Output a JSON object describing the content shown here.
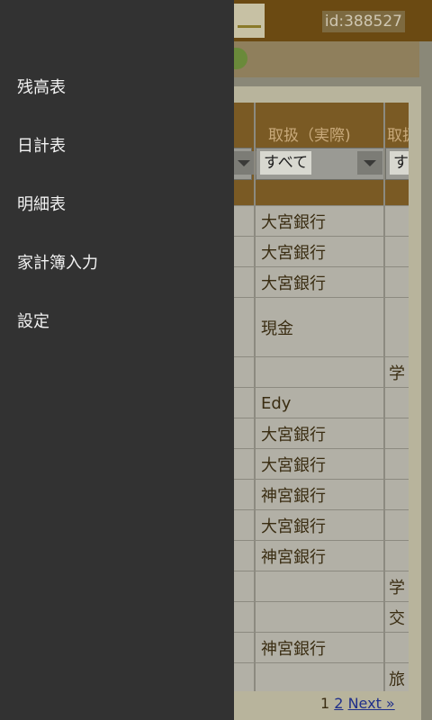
{
  "header": {
    "user_id": "id:388527"
  },
  "drawer": {
    "items": [
      {
        "label": "残高表"
      },
      {
        "label": "日計表"
      },
      {
        "label": "明細表"
      },
      {
        "label": "家計簿入力"
      },
      {
        "label": "設定"
      }
    ]
  },
  "table": {
    "columns": [
      {
        "label": "取扱（実際)",
        "filter": "すべて"
      },
      {
        "label": "取扱",
        "filter": "す"
      }
    ],
    "rows": [
      {
        "c1": "大宮銀行",
        "c2": ""
      },
      {
        "c1": "大宮銀行",
        "c2": ""
      },
      {
        "c1": "大宮銀行",
        "c2": ""
      },
      {
        "c1": "現金",
        "c2": ""
      },
      {
        "c1": "",
        "c2": "学"
      },
      {
        "c1": "Edy",
        "c2": ""
      },
      {
        "c1": "大宮銀行",
        "c2": ""
      },
      {
        "c1": "大宮銀行",
        "c2": ""
      },
      {
        "c1": "神宮銀行",
        "c2": ""
      },
      {
        "c1": "大宮銀行",
        "c2": ""
      },
      {
        "c1": "神宮銀行",
        "c2": ""
      },
      {
        "c1": "",
        "c2": "学"
      },
      {
        "c1": "",
        "c2": "交"
      },
      {
        "c1": "神宮銀行",
        "c2": ""
      },
      {
        "c1": "",
        "c2": "旅"
      }
    ]
  },
  "pager": {
    "current": "1",
    "page2": "2",
    "next": "Next »"
  }
}
